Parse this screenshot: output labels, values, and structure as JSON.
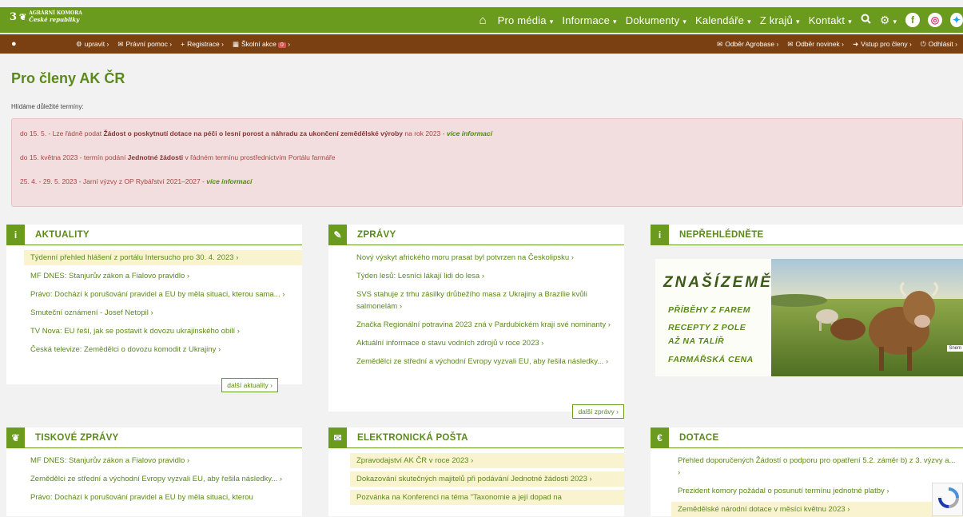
{
  "logo": {
    "mark": "3",
    "line1": "AGRÁRNÍ KOMORA",
    "line2": "České republiky"
  },
  "nav": {
    "items": [
      "Pro média",
      "Informace",
      "Dokumenty",
      "Kalendáře",
      "Z krajů",
      "Kontakt"
    ]
  },
  "memberbar": {
    "left": [
      "upravit",
      "Právní pomoc",
      "Registrace",
      "Školní akce"
    ],
    "school_badge": "0",
    "right": [
      "Odběr Agrobase",
      "Odběr novinek",
      "Vstup pro členy",
      "Odhlásit"
    ]
  },
  "page": {
    "title": "Pro členy AK ČR",
    "subtitle": "Hlídáme důležité termíny:"
  },
  "alert": {
    "l1_a": "do 15. 5. - Lze řádně podat ",
    "l1_b": "Žádost o poskytnutí dotace na péči o lesní porost a náhradu za ukončení zemědělské výroby",
    "l1_c": " na rok 2023 - ",
    "l1_more": "více informací",
    "l2_a": "do 15. května 2023 - termín podání ",
    "l2_b": "Jednotné žádosti",
    "l2_c": " v řádném termínu prostřednictvím Portálu farmáře",
    "l3_a": "25. 4. - 29. 5. 2023 - Jarní výzvy z OP Rybářství 2021–2027 - ",
    "l3_more": "více informací"
  },
  "aktuality": {
    "title": "AKTUALITY",
    "items": [
      "Týdenní přehled hlášení z portálu Intersucho pro 30. 4. 2023 ›",
      "MF DNES: Stanjurův zákon a Fialovo pravidlo ›",
      "Právo: Dochází k porušování pravidel a EU by měla situaci, kterou sama... ›",
      "Smuteční oznámení - Josef Netopil ›",
      "TV Nova: EU řeší, jak se postavit k dovozu ukrajinského obilí ›",
      "Česká televize: Zemědělci o dovozu komodit z Ukrajiny ›"
    ],
    "more": "další aktuality ›"
  },
  "zpravy": {
    "title": "ZPRÁVY",
    "items": [
      "Nový výskyt afrického moru prasat byl potvrzen na Českolipsku ›",
      "Týden lesů: Lesníci lákají lidi do lesa ›",
      "SVS stahuje z trhu zásilky drůbežího masa z Ukrajiny a Brazílie kvůli salmonelám ›",
      "Značka Regionální potravina 2023 zná v Pardubickém kraji své nominanty ›",
      "Aktuální informace o stavu vodních zdrojů v roce 2023 ›",
      "Zemědělci ze střední a východní Evropy vyzvali EU, aby řešila následky... ›"
    ],
    "more": "další zprávy ›"
  },
  "neprehlednete": {
    "title": "NEPŘEHLÉDNĚTE",
    "brand": "ZNAŠÍZEMĚ",
    "lines": [
      "PŘÍBĚHY Z FAREM",
      "RECEPTY Z POLE",
      "AŽ NA TALÍŘ",
      "FARMÁŘSKÁ CENA"
    ],
    "tag": "Snem"
  },
  "tiskove": {
    "title": "TISKOVÉ ZPRÁVY",
    "items": [
      "MF DNES: Stanjurův zákon a Fialovo pravidlo ›",
      "Zemědělci ze střední a východní Evropy vyzvali EU, aby řešila následky... ›",
      "Právo: Dochází k porušování pravidel a EU by měla situaci, kterou"
    ]
  },
  "posta": {
    "title": "ELEKTRONICKÁ POŠTA",
    "items": [
      "Zpravodajství AK ČR v roce 2023 ›",
      "Dokazování skutečných majitelů při podávání Jednotné žádosti 2023 ›",
      "Pozvánka na Konferenci na téma \"Taxonomie a její dopad na"
    ]
  },
  "dotace": {
    "title": "DOTACE",
    "items": [
      "Přehled doporučených Žádostí o podporu pro opatření 5.2. záměr b) z 3. výzvy a... ›",
      "Prezident komory požádal o posunutí termínu jednotné platby ›",
      "Zemědělské národní dotace v měsíci květnu 2023 ›"
    ]
  }
}
